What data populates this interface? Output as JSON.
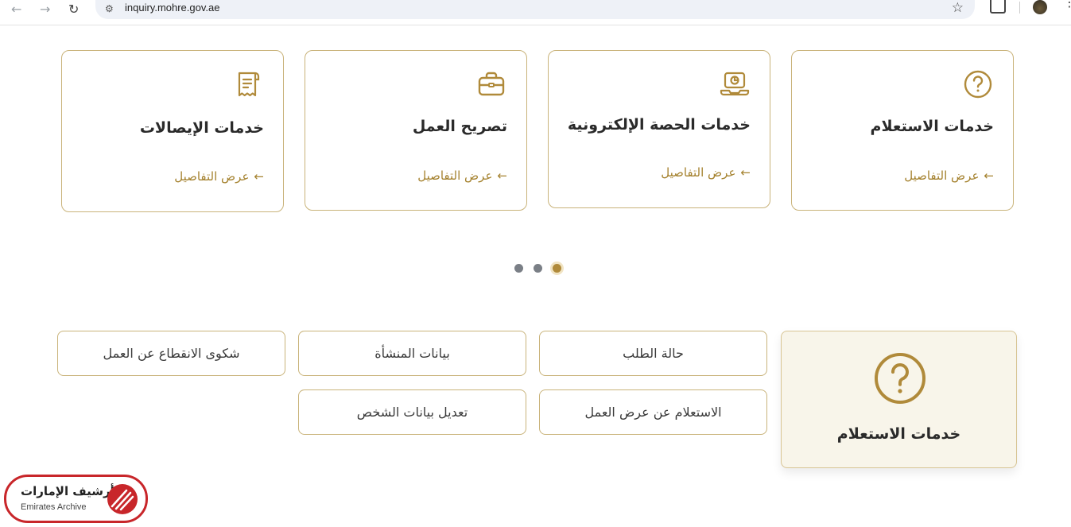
{
  "browser": {
    "url": "inquiry.mohre.gov.ae",
    "icons": [
      "back-arrow-icon",
      "forward-arrow-icon",
      "reload-icon",
      "site-info-icon",
      "star-icon",
      "extensions-icon",
      "profile-avatar",
      "menu-dots-icon"
    ]
  },
  "cards": [
    {
      "title": "خدمات الاستعلام",
      "link": "عرض التفاصيل",
      "icon": "question-circle-icon"
    },
    {
      "title": "خدمات الحصة الإلكترونية",
      "link": "عرض التفاصيل",
      "icon": "laptop-quota-icon"
    },
    {
      "title": "تصريح العمل",
      "link": "عرض التفاصيل",
      "icon": "briefcase-icon"
    },
    {
      "title": "خدمات الإيصالات",
      "link": "عرض التفاصيل",
      "icon": "receipt-icon"
    }
  ],
  "carousel": {
    "dots": 3,
    "active_index": 0
  },
  "featured": {
    "title": "خدمات الاستعلام",
    "icon": "question-circle-icon"
  },
  "options": [
    "حالة الطلب",
    "بيانات المنشأة",
    "شكوى الانقطاع عن العمل",
    "الاستعلام عن عرض العمل",
    "تعديل بيانات الشخص"
  ],
  "watermark": {
    "arabic": "أرشيف الإمارات",
    "english": "Emirates Archive"
  },
  "colors": {
    "accent": "#a5822f",
    "border": "#c9b37a",
    "featured_bg": "#f8f5ea",
    "watermark_red": "#c8262a"
  }
}
